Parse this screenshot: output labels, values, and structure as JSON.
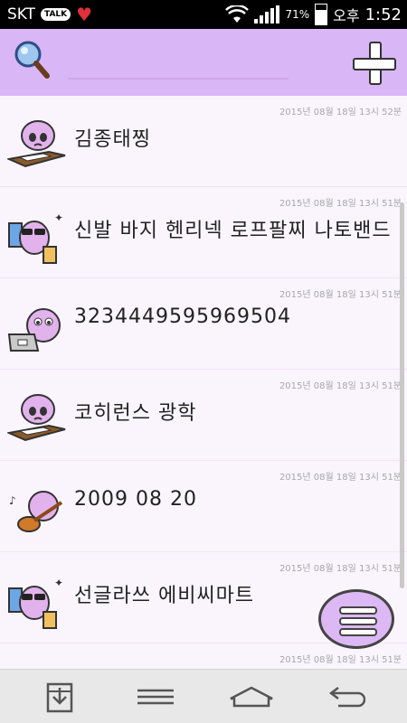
{
  "status_bar": {
    "carrier": "SKT",
    "talk_badge": "TALK",
    "battery_percent": "71%",
    "ampm": "오후",
    "time": "1:52",
    "signal_level": 4,
    "battery_level": 0.71
  },
  "header": {
    "search_icon": "magnifier-icon",
    "search_placeholder": "",
    "add_icon": "plus-icon",
    "accent_color": "#d9b6f5"
  },
  "memos": [
    {
      "timestamp": "2015년 08월 18일 13시 52분",
      "title": "김종태찡",
      "avatar": "crying-at-desk-icon"
    },
    {
      "timestamp": "2015년 08월 18일 13시 51분",
      "title": "신발 바지 헨리넥 로프팔찌 나토밴드",
      "avatar": "shopping-sunglasses-icon"
    },
    {
      "timestamp": "2015년 08월 18일 13시 51분",
      "title": "3234449595969504",
      "avatar": "laptop-icon"
    },
    {
      "timestamp": "2015년 08월 18일 13시 51분",
      "title": "코히런스 광학",
      "avatar": "crying-at-desk-icon"
    },
    {
      "timestamp": "2015년 08월 18일 13시 51분",
      "title": "2009 08 20",
      "avatar": "guitar-icon"
    },
    {
      "timestamp": "2015년 08월 18일 13시 51분",
      "title": "선글라쓰 에비씨마트",
      "avatar": "shopping-sunglasses-icon"
    },
    {
      "timestamp": "2015년 08월 18일 13시 51분",
      "title": "",
      "avatar": "character-icon"
    }
  ],
  "fab": {
    "icon": "menu-icon"
  },
  "nav_bar": {
    "items": [
      "download-icon",
      "menu-icon",
      "home-icon",
      "back-icon"
    ]
  }
}
